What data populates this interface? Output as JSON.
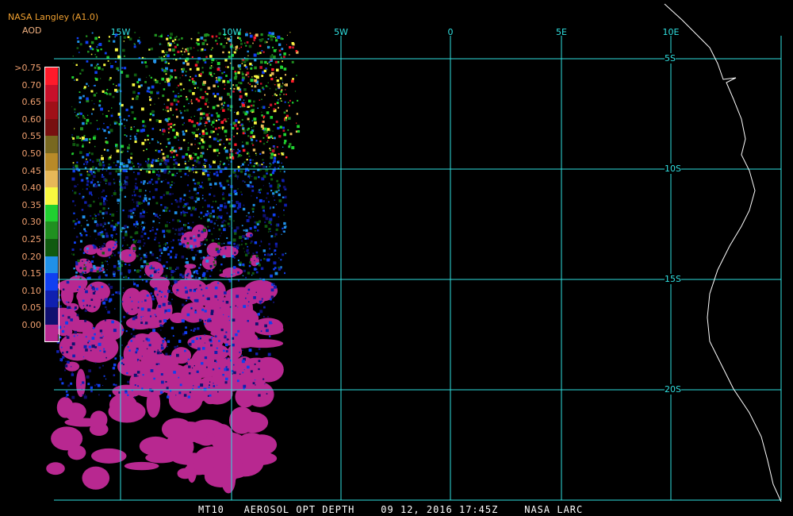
{
  "header": {
    "source": "NASA Langley (A1.0)",
    "variable": "AOD"
  },
  "legend": [
    {
      "label": ">0.75",
      "color": "#ff1a2a"
    },
    {
      "label": "0.70",
      "color": "#c8102a"
    },
    {
      "label": "0.65",
      "color": "#a01018"
    },
    {
      "label": "0.60",
      "color": "#781010"
    },
    {
      "label": "0.55",
      "color": "#786820"
    },
    {
      "label": "0.50",
      "color": "#b88a28"
    },
    {
      "label": "0.45",
      "color": "#e8b858"
    },
    {
      "label": "0.40",
      "color": "#f8f840"
    },
    {
      "label": "0.35",
      "color": "#20d030"
    },
    {
      "label": "0.30",
      "color": "#209020"
    },
    {
      "label": "0.25",
      "color": "#105a10"
    },
    {
      "label": "0.20",
      "color": "#2090e8"
    },
    {
      "label": "0.15",
      "color": "#1040f0"
    },
    {
      "label": "0.10",
      "color": "#1020b0"
    },
    {
      "label": "0.05",
      "color": "#101070"
    },
    {
      "label": "0.00",
      "color": "#b82890"
    }
  ],
  "grid": {
    "longitudes": [
      "15W",
      "10W",
      "5W",
      "0",
      "5E",
      "10E"
    ],
    "latitudes": [
      "5S",
      "10S",
      "15S",
      "20S"
    ],
    "color": "#30e0e0"
  },
  "footer": {
    "text": "MT10   AEROSOL OPT DEPTH    09 12, 2016 17:45Z    NASA LARC"
  }
}
